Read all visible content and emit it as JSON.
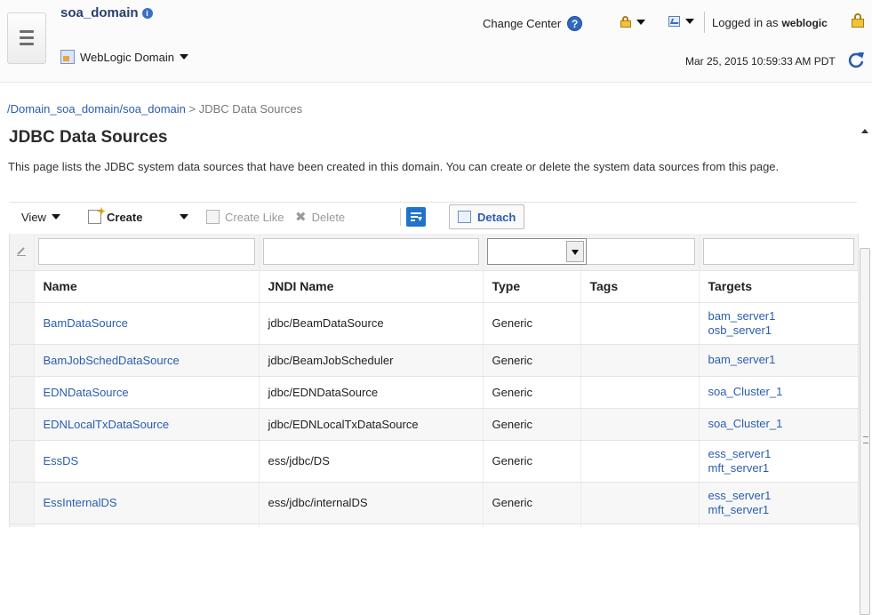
{
  "header": {
    "domain_name": "soa_domain",
    "info_icon": "info-icon",
    "weblogic_menu": "WebLogic Domain",
    "change_center": "Change Center",
    "logged_in_prefix": "Logged in as",
    "username": "weblogic",
    "datetime": "Mar 25, 2015 10:59:33 AM PDT",
    "icons": [
      "hamburger-menu-icon",
      "weblogic-domain-icon",
      "help-icon",
      "lock-icon",
      "chart-icon",
      "refresh-icon"
    ]
  },
  "breadcrumb": {
    "path": "/Domain_soa_domain/soa_domain",
    "separator": ">",
    "current": "JDBC Data Sources"
  },
  "page": {
    "title": "JDBC Data Sources",
    "description": "This page lists the JDBC system data sources that have been created in this domain. You can create or delete the system data sources from this page."
  },
  "toolbar": {
    "view": "View",
    "create": "Create",
    "create_like": "Create Like",
    "delete": "Delete",
    "detach": "Detach"
  },
  "table": {
    "columns": [
      "Name",
      "JNDI Name",
      "Type",
      "Tags",
      "Targets"
    ],
    "rows": [
      {
        "name": "BamDataSource",
        "jndi": "jdbc/BeamDataSource",
        "type": "Generic",
        "tags": "",
        "targets": [
          "bam_server1",
          "osb_server1"
        ]
      },
      {
        "name": "BamJobSchedDataSource",
        "jndi": "jdbc/BeamJobScheduler",
        "type": "Generic",
        "tags": "",
        "targets": [
          "bam_server1"
        ]
      },
      {
        "name": "EDNDataSource",
        "jndi": "jdbc/EDNDataSource",
        "type": "Generic",
        "tags": "",
        "targets": [
          "soa_Cluster_1"
        ]
      },
      {
        "name": "EDNLocalTxDataSource",
        "jndi": "jdbc/EDNLocalTxDataSource",
        "type": "Generic",
        "tags": "",
        "targets": [
          "soa_Cluster_1"
        ]
      },
      {
        "name": "EssDS",
        "jndi": "ess/jdbc/DS",
        "type": "Generic",
        "tags": "",
        "targets": [
          "ess_server1",
          "mft_server1"
        ]
      },
      {
        "name": "EssInternalDS",
        "jndi": "ess/jdbc/internalDS",
        "type": "Generic",
        "tags": "",
        "targets": [
          "ess_server1",
          "mft_server1"
        ]
      }
    ]
  },
  "colors": {
    "link": "#2a5db0",
    "accent_blue": "#1f73c9",
    "lock_yellow": "#f3c23a"
  }
}
